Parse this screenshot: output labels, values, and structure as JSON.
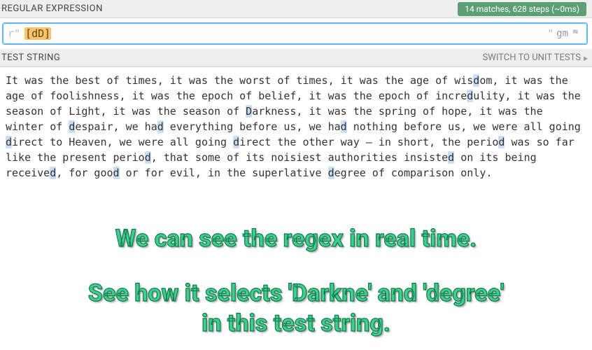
{
  "regex": {
    "section_label": "REGULAR EXPRESSION",
    "match_info": "14 matches, 628 steps (~0ms)",
    "prefix": "r\"",
    "charclass": "[dD]",
    "close_quote": "\"",
    "flags": "gm"
  },
  "test": {
    "section_label": "TEST STRING",
    "switch_label": "SWITCH TO UNIT TESTS",
    "content": "It was the best of times, it was the worst of times, it was the age of wisdom, it was the age of foolishness, it was the epoch of belief, it was the epoch of incredulity, it was the season of Light, it was the season of Darkness, it was the spring of hope, it was the winter of despair, we had everything before us, we had nothing before us, we were all going direct to Heaven, we were all going direct the other way – in short, the period was so far like the present period, that some of its noisiest authorities insisted on its being received, for good or for evil, in the superlative degree of comparison only."
  },
  "overlay": {
    "line1": "We can see the regex in real time.",
    "line2a": "See how it selects 'Darkne' and 'degree'",
    "line2b": "in this test string."
  },
  "chart_data": null
}
